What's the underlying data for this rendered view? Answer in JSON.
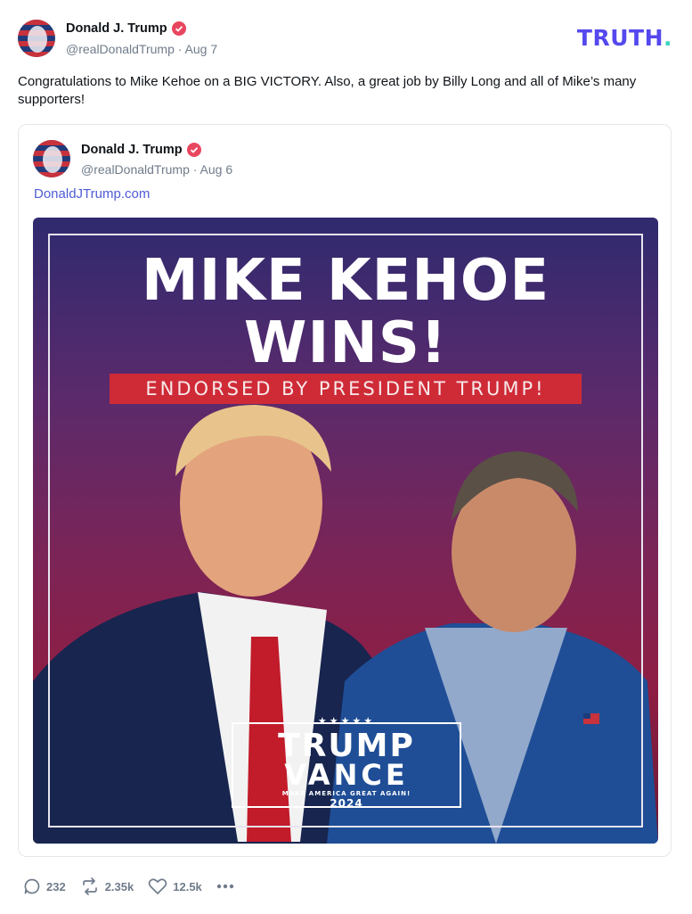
{
  "post": {
    "author": "Donald J. Trump",
    "handle": "@realDonaldTrump",
    "date": "Aug 7",
    "text": "Congratulations to Mike Kehoe on a BIG VICTORY. Also, a great job by Billy Long and all of Mike’s many supporters!"
  },
  "brand": {
    "label": "TRUTH",
    "dot": "."
  },
  "quote": {
    "author": "Donald J. Trump",
    "handle": "@realDonaldTrump",
    "date": "Aug 6",
    "link": "DonaldJTrump.com",
    "image": {
      "headline_1": "MIKE KEHOE",
      "headline_2": "WINS!",
      "banner": "ENDORSED BY PRESIDENT TRUMP!",
      "badge": {
        "stars": "★★★★★",
        "line1": "TRUMP",
        "line2": "VANCE",
        "slogan": "MAKE AMERICA GREAT AGAIN!",
        "year": "2024"
      }
    }
  },
  "actions": {
    "replies": "232",
    "reposts": "2.35k",
    "likes": "12.5k",
    "more_icon": "more-icon"
  },
  "colors": {
    "brand": "#5448ee",
    "link": "#4f5bd5",
    "verified": "#e8465f",
    "banner": "#cf2b37"
  }
}
